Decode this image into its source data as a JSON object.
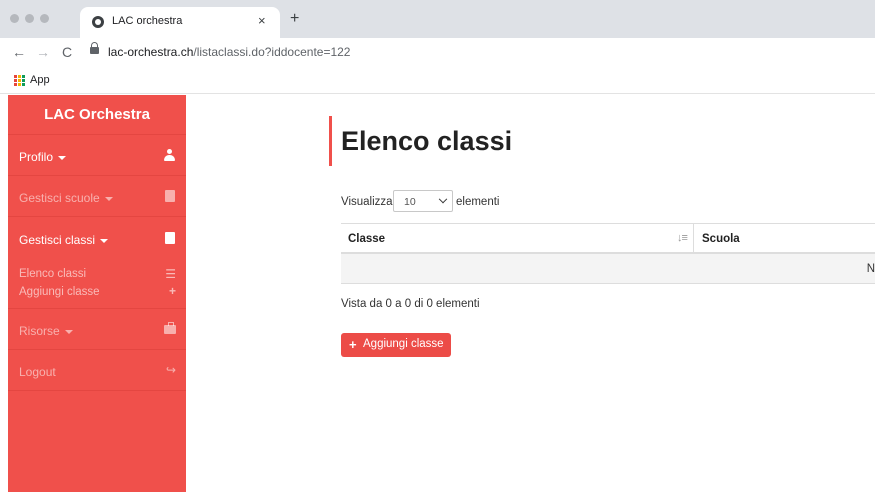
{
  "browser": {
    "tab_title": "LAC orchestra",
    "tab_close": "×",
    "new_tab": "+",
    "back": "←",
    "forward": "→",
    "reload": "C",
    "url_host": "lac-orchestra.ch",
    "url_path": "/listaclassi.do?iddocente=122",
    "bookmark_apps": "App"
  },
  "sidebar": {
    "brand": "LAC Orchestra",
    "items": [
      {
        "label": "Profilo",
        "icon": "user-icon",
        "enabled": true
      },
      {
        "label": "Gestisci scuole",
        "icon": "book-icon",
        "enabled": false
      },
      {
        "label": "Gestisci classi",
        "icon": "book-icon",
        "enabled": true
      },
      {
        "label": "Risorse",
        "icon": "briefcase-icon",
        "enabled": false
      },
      {
        "label": "Logout",
        "icon": "logout-icon",
        "enabled": false
      }
    ],
    "subitems": [
      {
        "label": "Elenco classi",
        "icon": "list-icon"
      },
      {
        "label": "Aggiungi classe",
        "icon": "plus-icon"
      }
    ]
  },
  "main": {
    "title": "Elenco classi",
    "length_prefix": "Visualizza",
    "length_value": "10",
    "length_suffix": "elementi",
    "columns": [
      "Classe",
      "Scuola"
    ],
    "empty_message": "N",
    "info": "Vista da 0 a 0 di 0 elementi",
    "add_button": "Aggiungi classe"
  },
  "colors": {
    "accent": "#f0504b",
    "sidebar_bg": "#f0504b"
  }
}
